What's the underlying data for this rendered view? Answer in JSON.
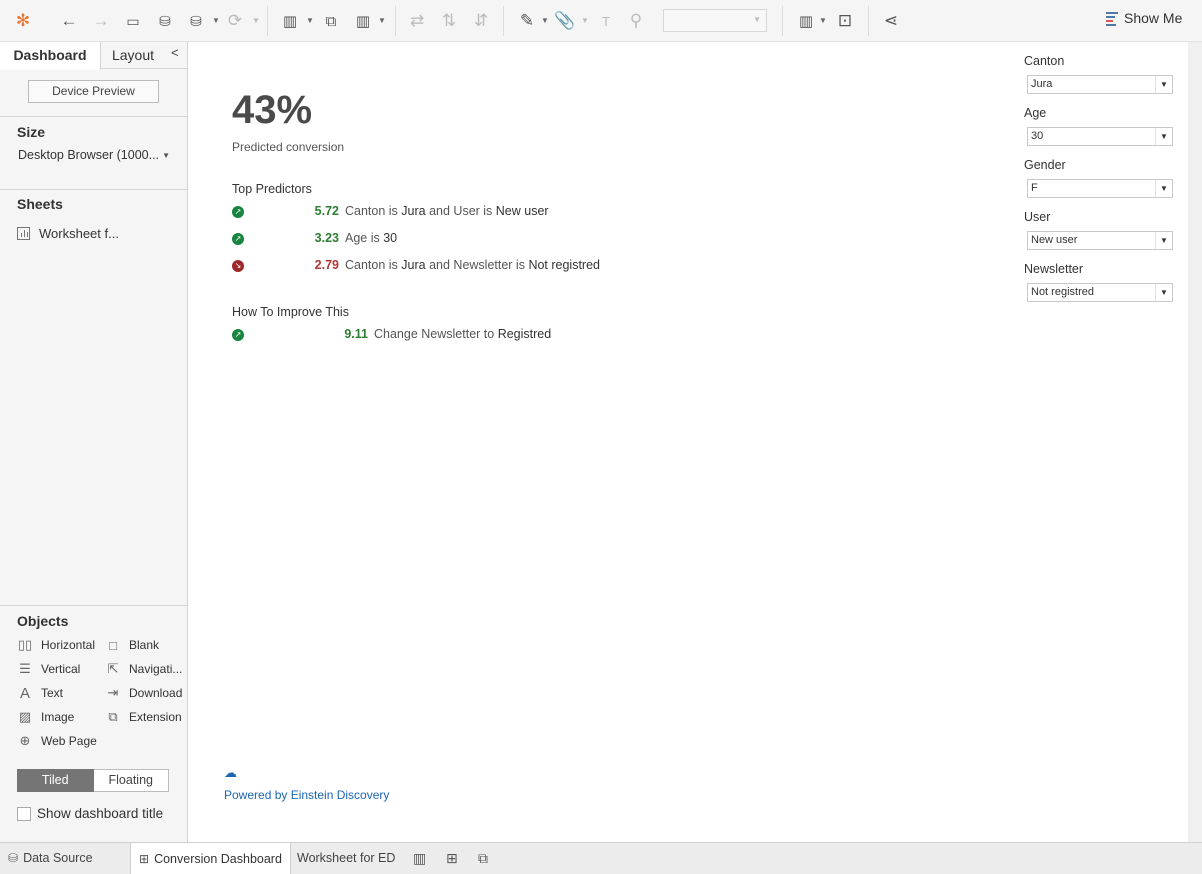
{
  "toolbar": {
    "dropdown_value": "",
    "show_me_label": "Show Me"
  },
  "left_panel": {
    "tabs": {
      "dashboard": "Dashboard",
      "layout": "Layout"
    },
    "device_preview": "Device Preview",
    "size_title": "Size",
    "size_value": "Desktop Browser (1000...",
    "sheets_title": "Sheets",
    "sheets": [
      "Worksheet f..."
    ],
    "objects_title": "Objects",
    "objects": [
      {
        "label": "Horizontal",
        "icon": "horizontal-container-icon"
      },
      {
        "label": "Blank",
        "icon": "blank-icon"
      },
      {
        "label": "Vertical",
        "icon": "vertical-container-icon"
      },
      {
        "label": "Navigati...",
        "icon": "navigation-icon"
      },
      {
        "label": "Text",
        "icon": "text-icon"
      },
      {
        "label": "Download",
        "icon": "download-icon"
      },
      {
        "label": "Image",
        "icon": "image-icon"
      },
      {
        "label": "Extension",
        "icon": "extension-icon"
      },
      {
        "label": "Web Page",
        "icon": "web-page-icon"
      }
    ],
    "layout_mode": {
      "tiled": "Tiled",
      "floating": "Floating",
      "selected": "Tiled"
    },
    "show_title_label": "Show dashboard title",
    "show_title_checked": false
  },
  "dashboard": {
    "big_value": "43%",
    "big_label": "Predicted conversion",
    "top_predictors_title": "Top Predictors",
    "predictors": [
      {
        "direction": "up",
        "value": "5.72",
        "parts": [
          "Canton is ",
          "Jura",
          " and User is ",
          "New user"
        ]
      },
      {
        "direction": "up",
        "value": "3.23",
        "parts": [
          "Age is ",
          "30"
        ]
      },
      {
        "direction": "down",
        "value": "2.79",
        "parts": [
          "Canton is ",
          "Jura",
          " and Newsletter is ",
          "Not registred"
        ]
      }
    ],
    "improve_title": "How To Improve This",
    "improvements": [
      {
        "direction": "up",
        "value": "9.11",
        "parts": [
          "Change Newsletter to ",
          "Registred"
        ]
      }
    ],
    "powered_by": "Powered by Einstein Discovery"
  },
  "filters": [
    {
      "label": "Canton",
      "value": "Jura"
    },
    {
      "label": "Age",
      "value": "30"
    },
    {
      "label": "Gender",
      "value": "F"
    },
    {
      "label": "User",
      "value": "New user"
    },
    {
      "label": "Newsletter",
      "value": "Not registred"
    }
  ],
  "bottom_tabs": {
    "data_source": "Data Source",
    "active_tab": "Conversion Dashboard",
    "other_tab": "Worksheet for ED"
  }
}
